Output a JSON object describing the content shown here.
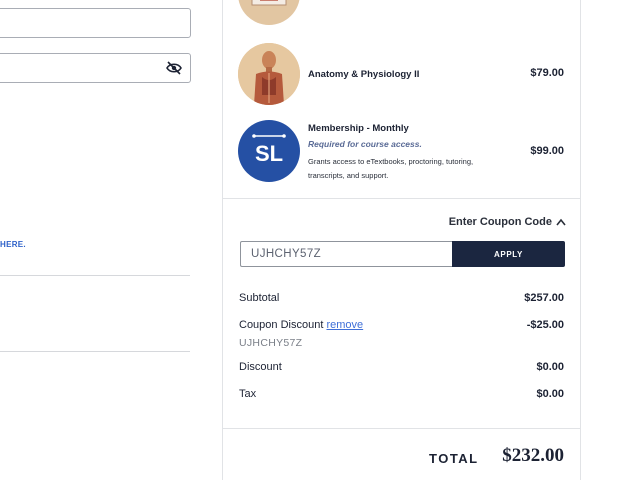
{
  "left": {
    "link_text": "HERE."
  },
  "items": [
    {
      "name": "",
      "price": ""
    },
    {
      "name": "Anatomy & Physiology II",
      "price": "$79.00"
    },
    {
      "name": "Membership - Monthly",
      "requirement": "Required for course access.",
      "description": "Grants access to eTextbooks, proctoring, tutoring, transcripts, and support.",
      "logo_text": "SL",
      "price": "$99.00"
    }
  ],
  "coupon": {
    "toggle_label": "Enter Coupon Code",
    "input_value": "UJHCHY57Z",
    "apply_label": "APPLY"
  },
  "summary": {
    "subtotal_label": "Subtotal",
    "subtotal_value": "$257.00",
    "coupon_discount_label": "Coupon Discount",
    "remove_label": "remove",
    "coupon_discount_value": "-$25.00",
    "applied_code": "UJHCHY57Z",
    "discount_label": "Discount",
    "discount_value": "$0.00",
    "tax_label": "Tax",
    "tax_value": "$0.00",
    "total_label": "TOTAL",
    "total_value": "$232.00"
  },
  "colors": {
    "apply_button": "#1b2640",
    "logo_background": "#2550a4",
    "link": "#3f6fd8"
  },
  "icons": [
    "eye-off-icon",
    "caret-up-icon"
  ]
}
